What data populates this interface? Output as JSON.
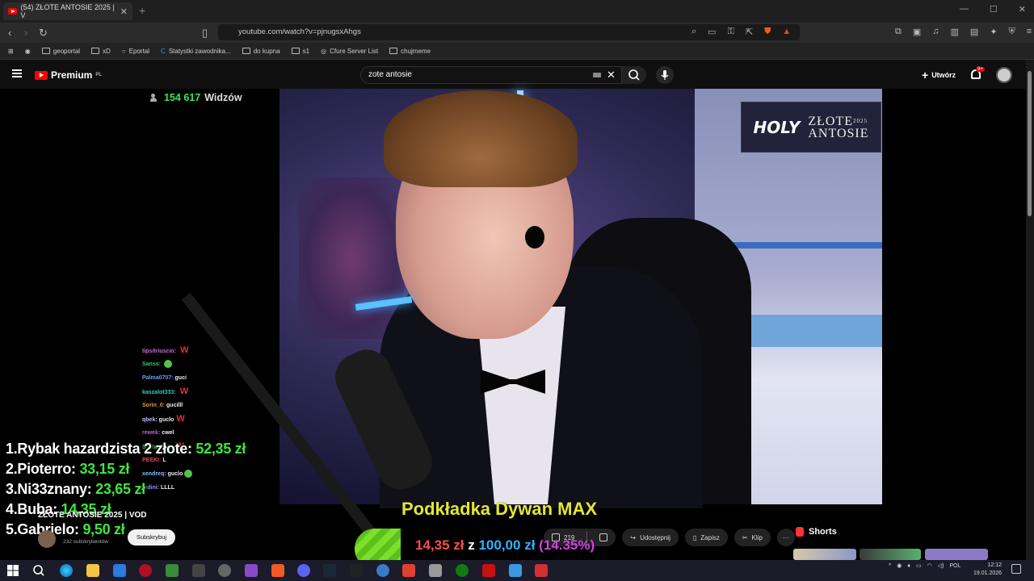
{
  "browser": {
    "tab_title": "(54) ZŁOTE ANTOSIE 2025 | V",
    "tab_close": "✕",
    "new_tab": "+",
    "window_controls": [
      "—",
      "☐",
      "✕"
    ],
    "url": "youtube.com/watch?v=pjnugsxAhgs",
    "bookmarks": [
      "geoportal",
      "xD",
      "Eportal",
      "Statystki zawodnika...",
      "do kupna",
      "s1",
      "Cfure Server List",
      "chujmeme"
    ]
  },
  "youtube_header": {
    "logo": "Premium",
    "logo_suffix": "PL",
    "search_value": "zote antosie",
    "clear_icon": "✕",
    "create_label": "Utwórz",
    "notifications_badge": "9+"
  },
  "stream": {
    "viewers_count": "154 617",
    "viewers_label": "Widzów",
    "brand_holy": "HOLY",
    "brand_name_1": "ZŁOTE",
    "brand_name_2": "ANTOSIE",
    "brand_year": "2025"
  },
  "chat": [
    {
      "user": "tipsitriuscio:",
      "msg": "",
      "emote": "W",
      "color": "#c86ad8"
    },
    {
      "user": "Sanss:",
      "msg": "",
      "emote": "smile",
      "color": "#37c46a"
    },
    {
      "user": "Palma0707:",
      "msg": "guci",
      "emote": "",
      "color": "#6aa0ff"
    },
    {
      "user": "kaszalot333:",
      "msg": "",
      "emote": "W",
      "color": "#34c9c9"
    },
    {
      "user": "Sorin_0:",
      "msg": "gucilll",
      "emote": "",
      "color": "#e0a030"
    },
    {
      "user": "qbek:",
      "msg": "guclo",
      "emote": "W",
      "color": "#bbbbff"
    },
    {
      "user": "rewek:",
      "msg": "cwel",
      "emote": "",
      "color": "#c85ad8"
    },
    {
      "user": "Szatan668:",
      "msg": "",
      "emote": "W",
      "color": "#50d050"
    },
    {
      "user": "PEEKI:",
      "msg": "L",
      "emote": "",
      "color": "#e05050"
    },
    {
      "user": "xendreq:",
      "msg": "guclo",
      "emote": "smile",
      "color": "#7ac0ff"
    },
    {
      "user": "mdini:",
      "msg": "LLLL",
      "emote": "",
      "color": "#9090ff"
    }
  ],
  "leaderboard": [
    {
      "rank": "1.",
      "name": "Rybak hazardzista 2 złote:",
      "amount": "52,35 zł"
    },
    {
      "rank": "2.",
      "name": "Pioterro:",
      "amount": "33,15 zł"
    },
    {
      "rank": "3.",
      "name": "Ni33znany:",
      "amount": "23,65 zł"
    },
    {
      "rank": "4.",
      "name": "Buba:",
      "amount": "14,35 zł"
    },
    {
      "rank": "5.",
      "name": "Gabrielo:",
      "amount": "9,50 zł"
    }
  ],
  "goal": {
    "title": "Podkładka Dywan MAX",
    "current": "14,35 zł",
    "connector": "z",
    "target": "100,00 zł",
    "percent": "(14.35%)",
    "progress_fraction": 0.1435
  },
  "video_meta": {
    "title": "ZŁOTE ANTOSIE 2025 | VOD",
    "subscribers": "232 subskrybentów",
    "subscribe_label": "Subskrybuj",
    "likes": "219",
    "share_label": "Udostępnij",
    "save_label": "Zapisz",
    "clip_label": "Klip",
    "more_label": "···",
    "shorts_label": "Shorts"
  },
  "taskbar": {
    "language": "POL",
    "time": "12:12",
    "date": "19.01.2026"
  },
  "colors": {
    "accent_red": "#ff0000",
    "viewers_green": "#39e651",
    "goal_yellow": "#e5e830",
    "goal_blue": "#2fb4ff",
    "goal_pink": "#d040e0"
  }
}
